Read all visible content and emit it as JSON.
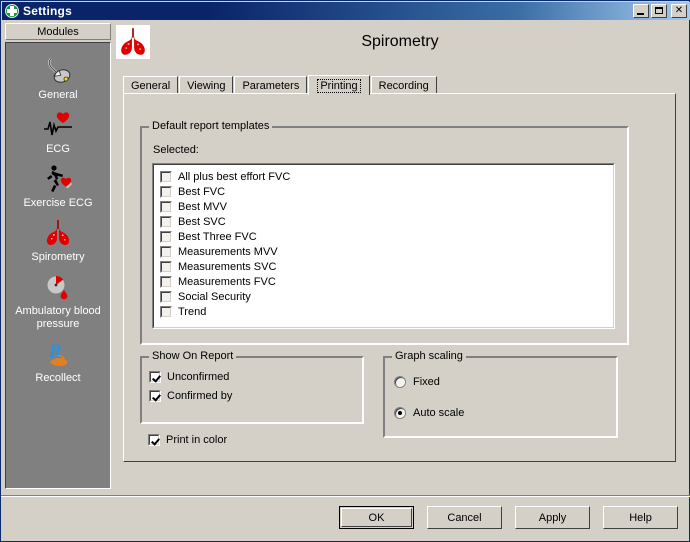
{
  "window": {
    "title": "Settings",
    "title_icon": "green-cross-icon",
    "controls": [
      {
        "name": "minimize-button",
        "glyph": "_"
      },
      {
        "name": "maximize-button",
        "glyph": "□"
      },
      {
        "name": "close-button",
        "glyph": "✕"
      }
    ]
  },
  "sidebar": {
    "header": "Modules",
    "items": [
      {
        "label": "General",
        "icon": "mouse-icon"
      },
      {
        "label": "ECG",
        "icon": "ecg-heart-icon"
      },
      {
        "label": "Exercise ECG",
        "icon": "runner-heart-icon"
      },
      {
        "label": "Spirometry",
        "icon": "lungs-icon"
      },
      {
        "label": "Ambulatory blood pressure",
        "icon": "blood-pressure-icon"
      },
      {
        "label": "Recollect",
        "icon": "rx-icon"
      }
    ]
  },
  "main": {
    "header_icon": "lungs-icon",
    "page_title": "Spirometry",
    "tabs": [
      {
        "label": "General",
        "active": false
      },
      {
        "label": "Viewing",
        "active": false
      },
      {
        "label": "Parameters",
        "active": false
      },
      {
        "label": "Printing",
        "active": true
      },
      {
        "label": "Recording",
        "active": false
      }
    ],
    "templates_group": {
      "title": "Default report templates",
      "selected_label": "Selected:",
      "items": [
        {
          "label": "All plus best effort FVC",
          "checked": false
        },
        {
          "label": "Best FVC",
          "checked": false
        },
        {
          "label": "Best MVV",
          "checked": false
        },
        {
          "label": "Best SVC",
          "checked": false
        },
        {
          "label": "Best Three FVC",
          "checked": false
        },
        {
          "label": "Measurements MVV",
          "checked": false
        },
        {
          "label": "Measurements SVC",
          "checked": false
        },
        {
          "label": "Measurements FVC",
          "checked": false
        },
        {
          "label": "Social Security",
          "checked": false
        },
        {
          "label": "Trend",
          "checked": false
        }
      ]
    },
    "show_on_report_group": {
      "title": "Show On Report",
      "unconfirmed": {
        "label": "Unconfirmed",
        "checked": true
      },
      "confirmed_by": {
        "label": "Confirmed by",
        "checked": true
      }
    },
    "print_in_color": {
      "label": "Print in color",
      "checked": true
    },
    "graph_scaling_group": {
      "title": "Graph scaling",
      "options": [
        {
          "label": "Fixed",
          "selected": false
        },
        {
          "label": "Auto scale",
          "selected": true
        }
      ]
    }
  },
  "buttons": [
    {
      "label": "OK",
      "default": true
    },
    {
      "label": "Cancel",
      "default": false
    },
    {
      "label": "Apply",
      "default": false
    },
    {
      "label": "Help",
      "default": false
    }
  ],
  "colors": {
    "face": "#d4d0c8",
    "title_bar_start": "#0a246a",
    "title_bar_end": "#a6caf0",
    "sidebar_bg": "#808080",
    "listbox_bg": "#ffffff",
    "icon_red": "#e00000",
    "icon_green": "#0a9b3e"
  }
}
